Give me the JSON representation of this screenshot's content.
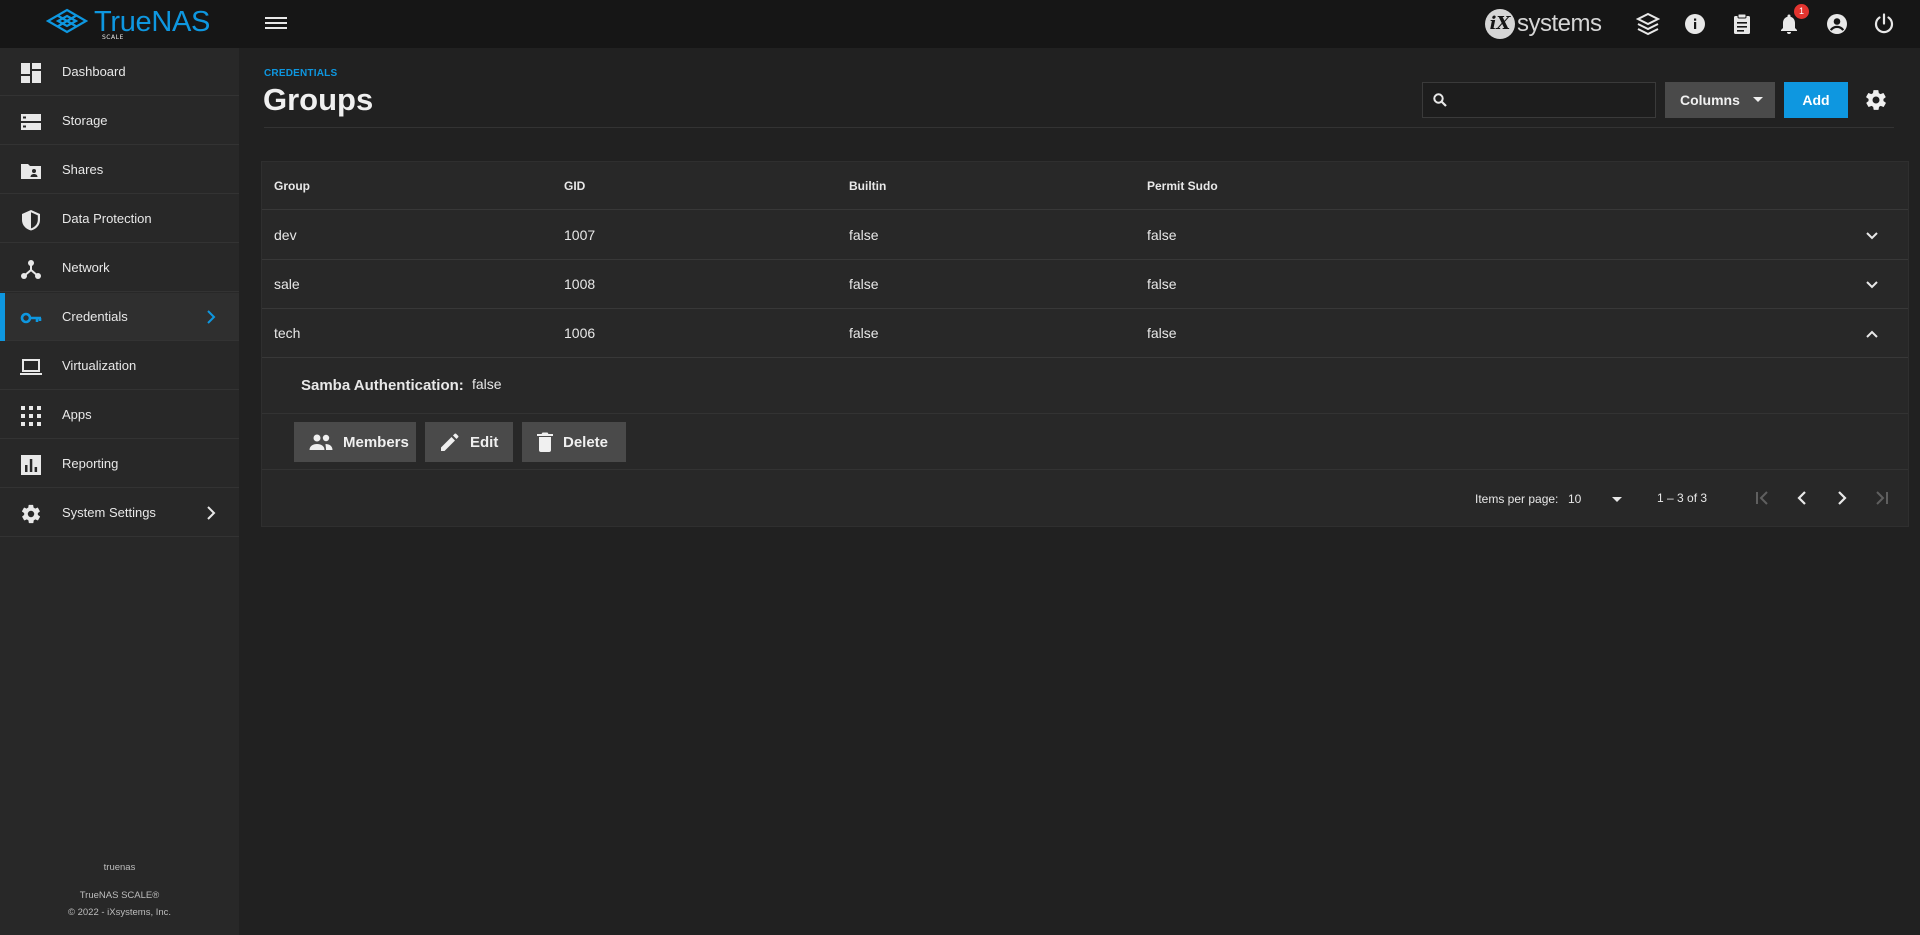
{
  "app": {
    "logo_text": "TrueNAS",
    "logo_sub": "SCALE",
    "vendor_logo_mark": "iX",
    "vendor_logo_text": "systems",
    "notification_count": "1"
  },
  "topbar_icons": [
    "menu-icon",
    "truecommand-icon",
    "info-icon",
    "jobs-clipboard-icon",
    "notifications-bell-icon",
    "account-icon",
    "power-icon"
  ],
  "sidebar": {
    "items": [
      {
        "label": "Dashboard",
        "icon": "dashboard-icon"
      },
      {
        "label": "Storage",
        "icon": "storage-icon"
      },
      {
        "label": "Shares",
        "icon": "shares-folder-icon"
      },
      {
        "label": "Data Protection",
        "icon": "shield-icon"
      },
      {
        "label": "Network",
        "icon": "network-icon"
      },
      {
        "label": "Credentials",
        "icon": "key-icon",
        "active": true
      },
      {
        "label": "Virtualization",
        "icon": "laptop-icon"
      },
      {
        "label": "Apps",
        "icon": "apps-grid-icon"
      },
      {
        "label": "Reporting",
        "icon": "chart-icon"
      },
      {
        "label": "System Settings",
        "icon": "gear-icon"
      }
    ],
    "hostname": "truenas",
    "product": "TrueNAS SCALE®",
    "copyright": "© 2022 - iXsystems, Inc."
  },
  "header": {
    "breadcrumb": "CREDENTIALS",
    "title": "Groups",
    "search_value": "",
    "columns_label": "Columns",
    "add_label": "Add"
  },
  "table": {
    "columns": [
      "Group",
      "GID",
      "Builtin",
      "Permit Sudo"
    ],
    "rows": [
      {
        "group": "dev",
        "gid": "1007",
        "builtin": "false",
        "sudo": "false",
        "expanded": false
      },
      {
        "group": "sale",
        "gid": "1008",
        "builtin": "false",
        "sudo": "false",
        "expanded": false
      },
      {
        "group": "tech",
        "gid": "1006",
        "builtin": "false",
        "sudo": "false",
        "expanded": true
      }
    ],
    "detail": {
      "label": "Samba Authentication:",
      "value": "false"
    },
    "actions": {
      "members": "Members",
      "edit": "Edit",
      "delete": "Delete"
    }
  },
  "pager": {
    "items_label": "Items per page:",
    "page_size": "10",
    "range": "1 – 3 of 3"
  },
  "colors": {
    "accent": "#0e97e0",
    "background": "#212121",
    "sidebar": "#282828",
    "topbar": "#161616",
    "badge": "#e3342f"
  }
}
